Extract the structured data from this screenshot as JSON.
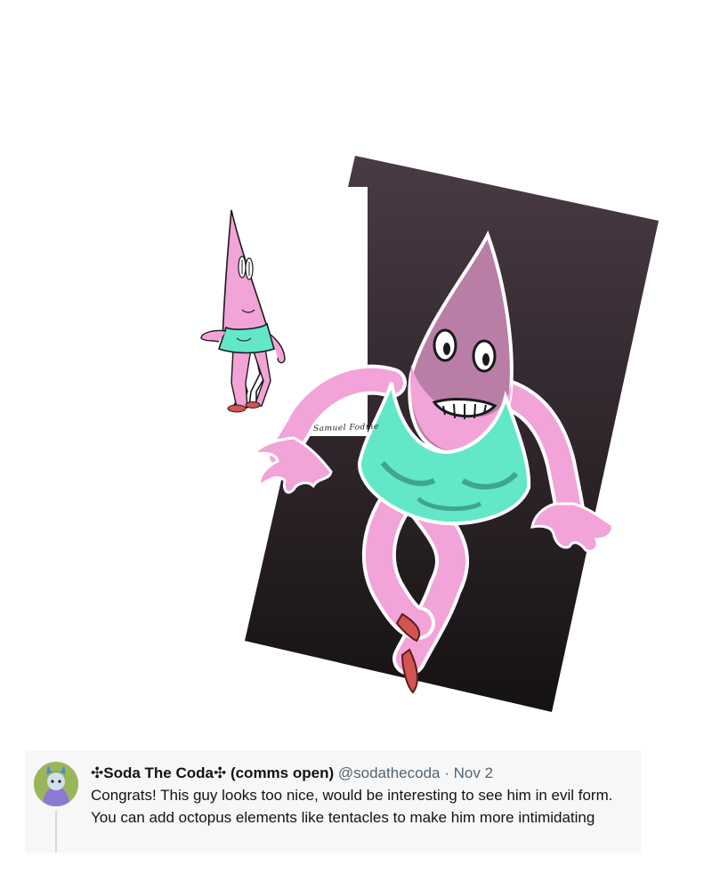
{
  "artwork": {
    "signature": "Samuel Fodme"
  },
  "tweet": {
    "display_name": "✣Soda The Coda✣ (comms open)",
    "handle": "@sodathecoda",
    "separator": "·",
    "date": "Nov 2",
    "text": "Congrats! This guy looks too nice, would be interesting to see him in evil form. You can add octopus elements like tentacles to make him more intimidating"
  },
  "colors": {
    "panel_top": "#4a3a44",
    "panel_bottom": "#151213",
    "skin": "#f2a3d8",
    "skin_shadow": "#b97ea6",
    "dress": "#62e8c8",
    "dress_shadow": "#3fa68e",
    "shoe": "#d4544f",
    "avatar_bg": "#9bb55a",
    "card_bg": "#f7f7f7",
    "muted_text": "#536471"
  }
}
